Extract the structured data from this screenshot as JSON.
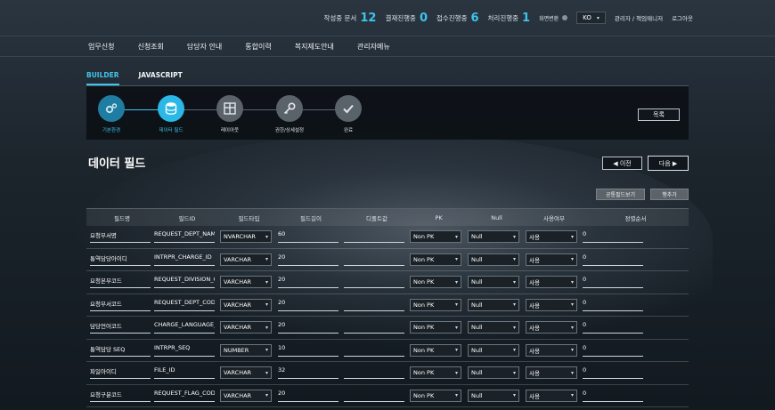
{
  "topbar": {
    "stats": [
      {
        "label": "작성중 문서",
        "value": "12"
      },
      {
        "label": "결재진행중",
        "value": "0"
      },
      {
        "label": "접수진행중",
        "value": "6"
      },
      {
        "label": "처리진행중",
        "value": "1"
      }
    ],
    "screen_toggle": "화면변환",
    "lang": "KO",
    "user": "관리자 / 책임매니저",
    "logout": "로그아웃"
  },
  "nav": [
    "업무신청",
    "신청조회",
    "담당자 안내",
    "통합이력",
    "복지제도안내",
    "관리자메뉴"
  ],
  "tabs": [
    {
      "label": "BUILDER",
      "active": true
    },
    {
      "label": "JAVASCRIPT",
      "active": false
    }
  ],
  "steps": [
    {
      "label": "기본환경",
      "icon": "gears-icon",
      "state": "done"
    },
    {
      "label": "데이터 필드",
      "icon": "database-icon",
      "state": "current"
    },
    {
      "label": "레이아웃",
      "icon": "layout-icon",
      "state": "todo"
    },
    {
      "label": "권한/상세설정",
      "icon": "key-icon",
      "state": "todo"
    },
    {
      "label": "완료",
      "icon": "check-icon",
      "state": "todo"
    }
  ],
  "list_button": "목록",
  "page_title": "데이터 필드",
  "prev_button": "◀ 이전",
  "next_button": "다음 ▶",
  "common_field_button": "공통필드보기",
  "add_row_button": "행추가",
  "table": {
    "headers": [
      "필드명",
      "필드ID",
      "필드타입",
      "필드길이",
      "디폴트값",
      "PK",
      "Null",
      "사용여부",
      "정렬순서"
    ],
    "rows": [
      {
        "name": "요청부서명",
        "id": "REQUEST_DEPT_NAM",
        "type": "NVARCHAR",
        "length": "60",
        "default": "",
        "pk": "Non PK",
        "null": "Null",
        "use": "사용",
        "order": "0"
      },
      {
        "name": "통역담당아이디",
        "id": "INTRPR_CHARGE_ID",
        "type": "VARCHAR",
        "length": "20",
        "default": "",
        "pk": "Non PK",
        "null": "Null",
        "use": "사용",
        "order": "0"
      },
      {
        "name": "요청본부코드",
        "id": "REQUEST_DIVISION_C",
        "type": "VARCHAR",
        "length": "20",
        "default": "",
        "pk": "Non PK",
        "null": "Null",
        "use": "사용",
        "order": "0"
      },
      {
        "name": "요청부서코드",
        "id": "REQUEST_DEPT_CODE",
        "type": "VARCHAR",
        "length": "20",
        "default": "",
        "pk": "Non PK",
        "null": "Null",
        "use": "사용",
        "order": "0"
      },
      {
        "name": "담당언어코드",
        "id": "CHARGE_LANGUAGE_",
        "type": "VARCHAR",
        "length": "20",
        "default": "",
        "pk": "Non PK",
        "null": "Null",
        "use": "사용",
        "order": "0"
      },
      {
        "name": "통역담당 SEQ",
        "id": "INTRPR_SEQ",
        "type": "NUMBER",
        "length": "10",
        "default": "",
        "pk": "Non PK",
        "null": "Null",
        "use": "사용",
        "order": "0"
      },
      {
        "name": "파일아이디",
        "id": "FILE_ID",
        "type": "VARCHAR",
        "length": "32",
        "default": "",
        "pk": "Non PK",
        "null": "Null",
        "use": "사용",
        "order": "0"
      },
      {
        "name": "요청구분코드",
        "id": "REQUEST_FLAG_CODE",
        "type": "VARCHAR",
        "length": "20",
        "default": "",
        "pk": "Non PK",
        "null": "Null",
        "use": "사용",
        "order": "0"
      }
    ]
  }
}
